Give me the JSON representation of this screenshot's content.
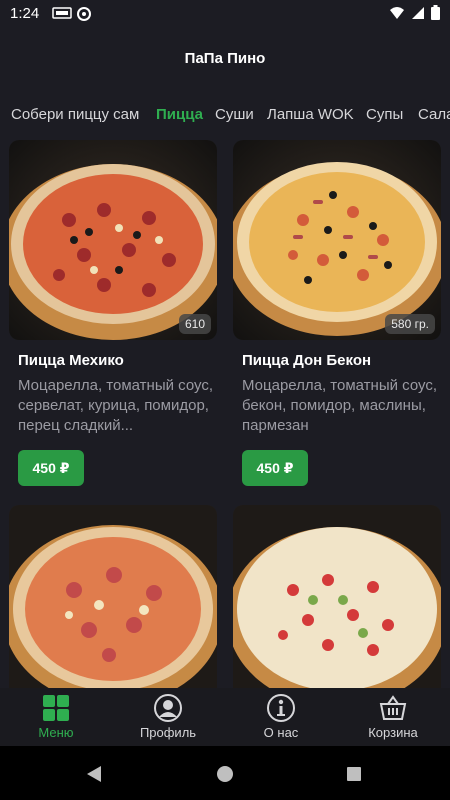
{
  "status_bar": {
    "time": "1:24"
  },
  "app": {
    "title": "ПаПа Пино"
  },
  "tabs": [
    {
      "label": "Собери пиццу сам"
    },
    {
      "label": "Пицца"
    },
    {
      "label": "Суши"
    },
    {
      "label": "Лапша WOK"
    },
    {
      "label": "Супы"
    },
    {
      "label": "Сала"
    }
  ],
  "products": [
    {
      "name": "Пицца Мехико",
      "weight": "610",
      "description": "Моцарелла, томатный соус, сервелат, курица, помидор, перец сладкий...",
      "price": "450 ₽"
    },
    {
      "name": "Пицца Дон Бекон",
      "weight": "580 гр.",
      "description": "Моцарелла, томатный соус, бекон, помидор, маслины, пармезан",
      "price": "450 ₽"
    },
    {
      "name": "",
      "weight": "",
      "description": "",
      "price": ""
    },
    {
      "name": "",
      "weight": "",
      "description": "",
      "price": ""
    }
  ],
  "bottom_nav": [
    {
      "label": "Меню",
      "icon": "grid-icon",
      "active": true
    },
    {
      "label": "Профиль",
      "icon": "profile-icon",
      "active": false
    },
    {
      "label": "О нас",
      "icon": "info-icon",
      "active": false
    },
    {
      "label": "Корзина",
      "icon": "basket-icon",
      "active": false
    }
  ],
  "colors": {
    "background": "#1c1c23",
    "accent": "#2fae50",
    "price_button": "#2a9a44"
  }
}
